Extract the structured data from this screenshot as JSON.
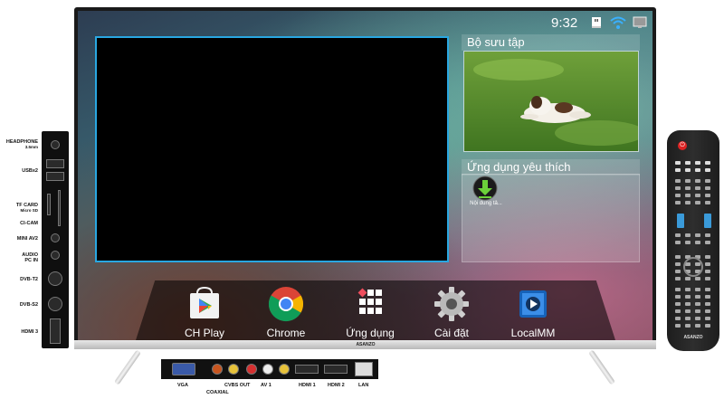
{
  "status_bar": {
    "time": "9:32",
    "icons": [
      "usb-icon",
      "wifi-icon",
      "display-icon"
    ]
  },
  "widgets": {
    "collection": {
      "title": "Bộ sưu tập"
    },
    "favorites": {
      "title": "Ứng dụng yêu thích",
      "apps": [
        {
          "label": "Nội dung tả...",
          "icon": "download-icon"
        }
      ]
    }
  },
  "dock": {
    "items": [
      {
        "label": "CH Play",
        "icon": "play-store-icon"
      },
      {
        "label": "Chrome",
        "icon": "chrome-icon"
      },
      {
        "label": "Ứng dụng",
        "icon": "apps-grid-icon"
      },
      {
        "label": "Cài đặt",
        "icon": "settings-gear-icon"
      },
      {
        "label": "LocalMM",
        "icon": "local-media-icon"
      }
    ]
  },
  "tv": {
    "brand": "ASANZO"
  },
  "side_ports": [
    {
      "label": "HEADPHONE",
      "sub": "3.5mm"
    },
    {
      "label": "USBx2",
      "sub": ""
    },
    {
      "label": "TF CARD",
      "sub": "Micro SD"
    },
    {
      "label": "CI-CAM",
      "sub": ""
    },
    {
      "label": "MINI AV2",
      "sub": ""
    },
    {
      "label": "AUDIO",
      "sub": "PC IN"
    },
    {
      "label": "DVB-T2",
      "sub": ""
    },
    {
      "label": "DVB-S2",
      "sub": ""
    },
    {
      "label": "HDMI 3",
      "sub": ""
    }
  ],
  "bottom_ports": [
    "VGA",
    "COAXIAL",
    "CVBS OUT",
    "AV 1",
    "HDMI 1",
    "HDMI 2",
    "LAN"
  ],
  "remote": {
    "brand": "ASANZO",
    "power_symbol": "⏻"
  }
}
